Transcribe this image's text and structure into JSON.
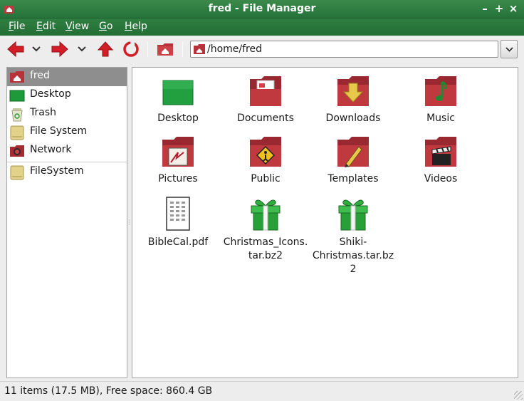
{
  "window": {
    "title": "fred - File Manager",
    "controls": [
      "–",
      "+",
      "×"
    ]
  },
  "menu": {
    "items": [
      {
        "first": "F",
        "rest": "ile"
      },
      {
        "first": "E",
        "rest": "dit"
      },
      {
        "first": "V",
        "rest": "iew"
      },
      {
        "first": "G",
        "rest": "o"
      },
      {
        "first": "H",
        "rest": "elp"
      }
    ]
  },
  "location": {
    "path": "/home/fred"
  },
  "sidebar": {
    "items": [
      {
        "label": "fred",
        "icon": "home-icon"
      },
      {
        "label": "Desktop",
        "icon": "desktop-icon"
      },
      {
        "label": "Trash",
        "icon": "trash-icon"
      },
      {
        "label": "File System",
        "icon": "drive-icon"
      },
      {
        "label": "Network",
        "icon": "network-icon"
      },
      {
        "label": "FileSystem",
        "icon": "drive-icon"
      }
    ]
  },
  "files": [
    {
      "name": "Desktop",
      "icon": "desktop-folder-icon"
    },
    {
      "name": "Documents",
      "icon": "documents-folder-icon"
    },
    {
      "name": "Downloads",
      "icon": "downloads-folder-icon"
    },
    {
      "name": "Music",
      "icon": "music-folder-icon"
    },
    {
      "name": "Pictures",
      "icon": "pictures-folder-icon"
    },
    {
      "name": "Public",
      "icon": "public-folder-icon"
    },
    {
      "name": "Templates",
      "icon": "templates-folder-icon"
    },
    {
      "name": "Videos",
      "icon": "videos-folder-icon"
    },
    {
      "name": "BibleCal.pdf",
      "icon": "pdf-file-icon"
    },
    {
      "name": "Christmas_Icons.tar.bz2",
      "icon": "archive-gift-icon"
    },
    {
      "name": "Shiki-Christmas.tar.bz2",
      "icon": "archive-gift-icon"
    }
  ],
  "status": {
    "text": "11 items (17.5 MB), Free space: 860.4 GB"
  },
  "colors": {
    "titlebar": "#2f7f42",
    "folder": "#b8323a",
    "selection": "#8e8e8e"
  }
}
